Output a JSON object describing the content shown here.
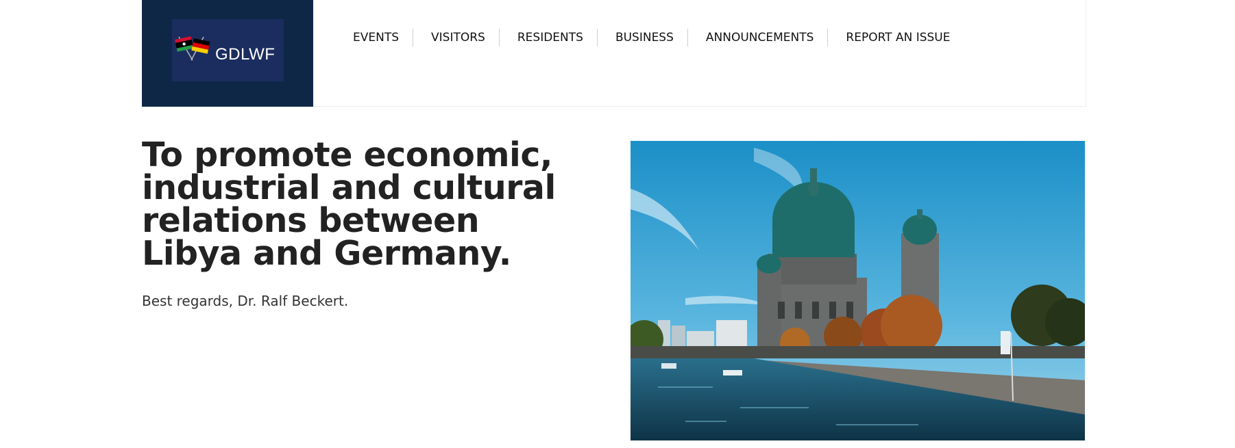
{
  "logo": {
    "text": "GDLWF",
    "flags": [
      "libya-flag-icon",
      "germany-flag-icon"
    ]
  },
  "nav": {
    "items": [
      "EVENTS",
      "VISITORS",
      "RESIDENTS",
      "BUSINESS",
      "ANNOUNCEMENTS",
      "REPORT AN ISSUE"
    ]
  },
  "hero": {
    "title": "To promote economic, industrial and cultural relations between Libya and Germany.",
    "subtitle": "Best regards, Dr. Ralf Beckert."
  },
  "colors": {
    "header_dark": "#0f2747",
    "logo_panel": "#1b2d5e",
    "text": "#222222"
  }
}
